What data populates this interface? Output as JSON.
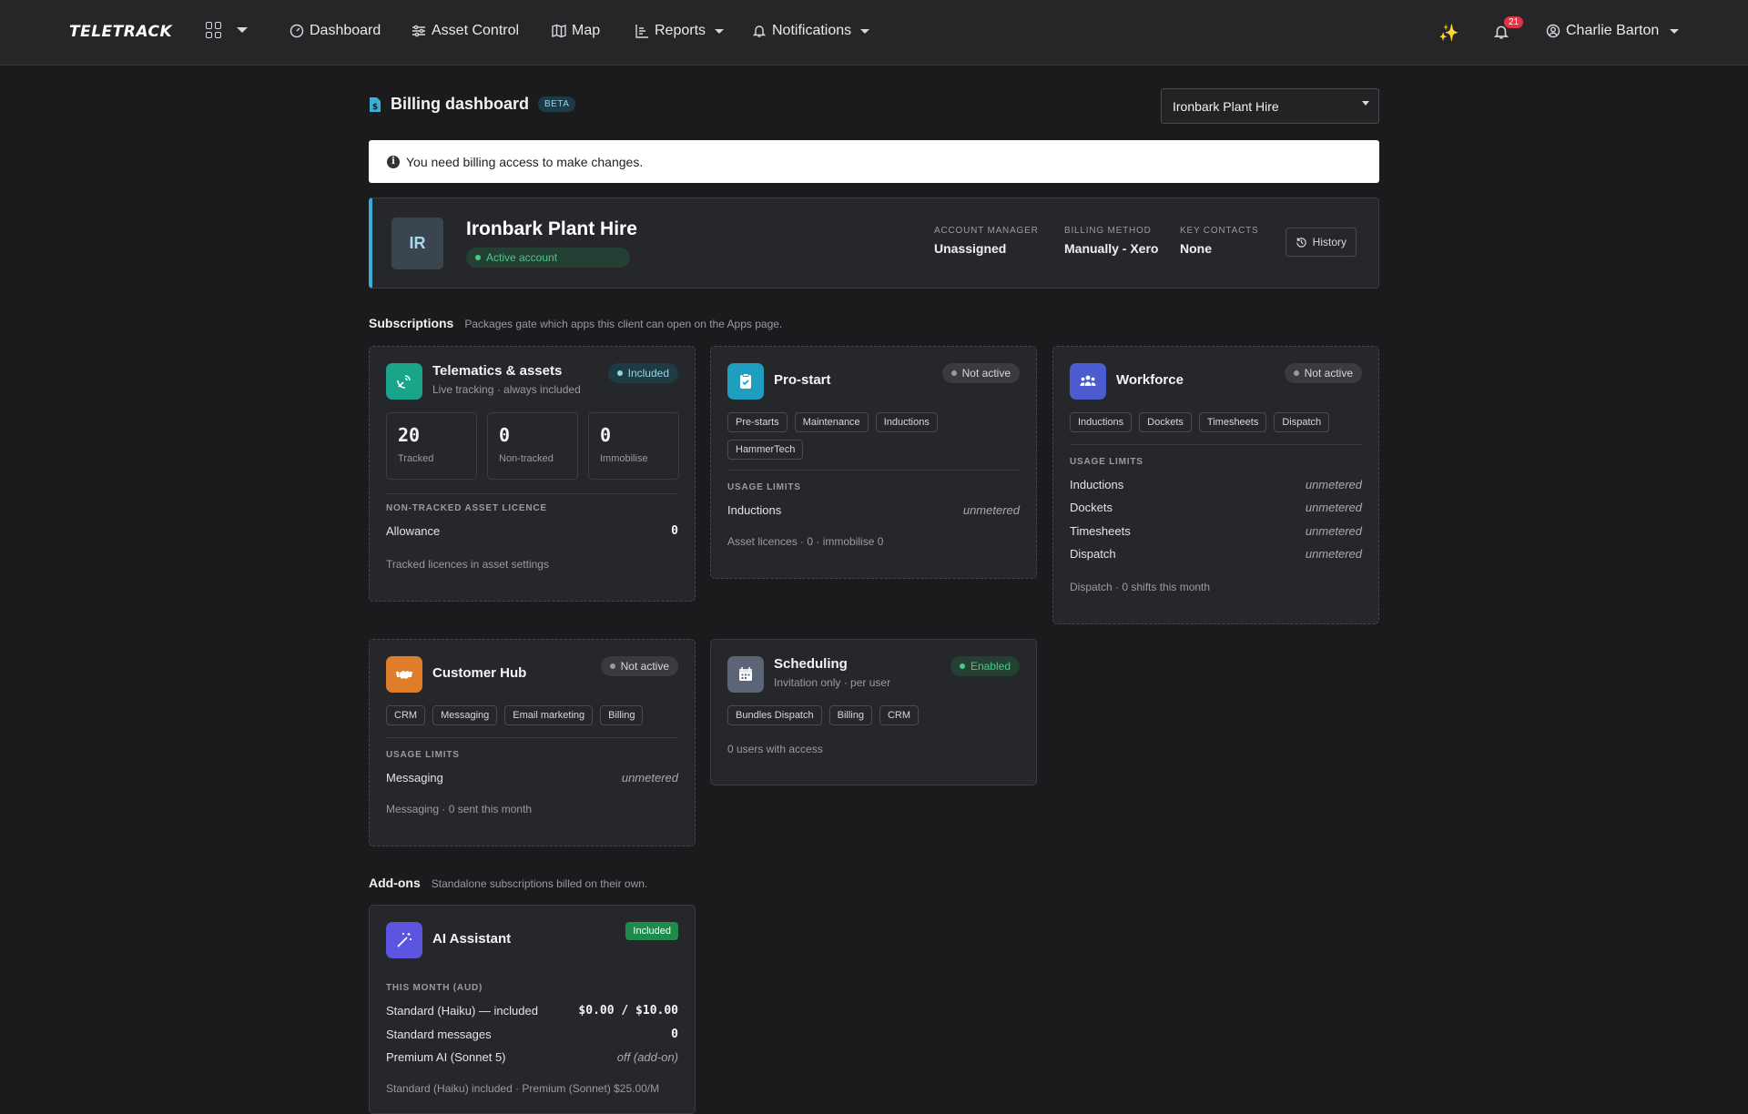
{
  "nav": {
    "brand": "TELETRACK",
    "items": [
      {
        "label": "Dashboard"
      },
      {
        "label": "Asset Control"
      },
      {
        "label": "Map"
      },
      {
        "label": "Reports"
      },
      {
        "label": "Notifications"
      }
    ],
    "notification_count": "21",
    "user_name": "Charlie Barton"
  },
  "header": {
    "title": "Billing dashboard",
    "beta": "BETA",
    "client_select": "Ironbark Plant Hire"
  },
  "alert": {
    "text": "You need billing access to make changes."
  },
  "account": {
    "initials": "IR",
    "name": "Ironbark Plant Hire",
    "status": "Active account",
    "manager_label": "ACCOUNT MANAGER",
    "manager": "Unassigned",
    "billing_label": "BILLING METHOD",
    "billing": "Manually - Xero",
    "contacts_label": "KEY CONTACTS",
    "contacts": "None",
    "history": "History"
  },
  "subscriptions": {
    "title": "Subscriptions",
    "subtitle": "Packages gate which apps this client can open on the Apps page."
  },
  "telematics": {
    "title": "Telematics & assets",
    "sub": "Live tracking · always included",
    "badge": "Included",
    "stats": [
      {
        "num": "20",
        "label": "Tracked"
      },
      {
        "num": "0",
        "label": "Non-tracked"
      },
      {
        "num": "0",
        "label": "Immobilise"
      }
    ],
    "section": "NON-TRACKED ASSET LICENCE",
    "allowance_label": "Allowance",
    "allowance": "0",
    "foot": "Tracked licences in asset settings"
  },
  "prestart": {
    "title": "Pro-start",
    "badge": "Not active",
    "tags": [
      "Pre-starts",
      "Maintenance",
      "Inductions",
      "HammerTech"
    ],
    "section": "USAGE LIMITS",
    "row_label": "Inductions",
    "row_value": "unmetered",
    "foot": "Asset licences · 0 · immobilise 0"
  },
  "workforce": {
    "title": "Workforce",
    "badge": "Not active",
    "tags": [
      "Inductions",
      "Dockets",
      "Timesheets",
      "Dispatch"
    ],
    "section": "USAGE LIMITS",
    "rows": [
      {
        "label": "Inductions",
        "value": "unmetered"
      },
      {
        "label": "Dockets",
        "value": "unmetered"
      },
      {
        "label": "Timesheets",
        "value": "unmetered"
      },
      {
        "label": "Dispatch",
        "value": "unmetered"
      }
    ],
    "foot": "Dispatch · 0 shifts this month"
  },
  "customerhub": {
    "title": "Customer Hub",
    "badge": "Not active",
    "tags": [
      "CRM",
      "Messaging",
      "Email marketing",
      "Billing"
    ],
    "section": "USAGE LIMITS",
    "row_label": "Messaging",
    "row_value": "unmetered",
    "foot": "Messaging · 0 sent this month"
  },
  "scheduling": {
    "title": "Scheduling",
    "sub": "Invitation only · per user",
    "badge": "Enabled",
    "tags": [
      "Bundles Dispatch",
      "Billing",
      "CRM"
    ],
    "foot": "0 users with access"
  },
  "addons": {
    "title": "Add-ons",
    "subtitle": "Standalone subscriptions billed on their own."
  },
  "ai": {
    "title": "AI Assistant",
    "badge": "Included",
    "section": "THIS MONTH (AUD)",
    "rows": [
      {
        "label": "Standard (Haiku) — included",
        "value": "$0.00 / $10.00"
      },
      {
        "label": "Standard messages",
        "value": "0"
      },
      {
        "label": "Premium AI (Sonnet 5)",
        "value": "off (add-on)"
      }
    ],
    "foot": "Standard (Haiku) included · Premium (Sonnet) $25.00/M"
  },
  "colors": {
    "teal": "#1aa58a",
    "cyan": "#1f9ec0",
    "indigo": "#4b5bd0",
    "orange": "#e07d2a",
    "slate": "#5c6478",
    "violet": "#5b55e0",
    "accent_border": "#3aaed8"
  }
}
